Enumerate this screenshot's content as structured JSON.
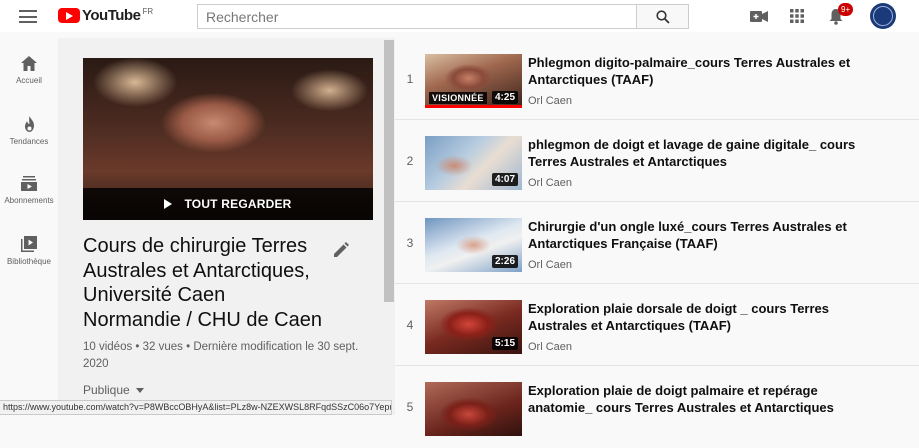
{
  "header": {
    "logo_text": "YouTube",
    "logo_country": "FR",
    "search_placeholder": "Rechercher",
    "notification_count": "9+",
    "avatar_label": "CAEN"
  },
  "sidebar": {
    "items": [
      {
        "label": "Accueil",
        "icon": "home-icon"
      },
      {
        "label": "Tendances",
        "icon": "fire-icon"
      },
      {
        "label": "Abonnements",
        "icon": "subscriptions-icon"
      },
      {
        "label": "Bibliothèque",
        "icon": "library-icon"
      }
    ]
  },
  "playlist": {
    "play_all_label": "TOUT REGARDER",
    "title": "Cours de chirurgie Terres Australes et Antarctiques, Université Caen Normandie / CHU de Caen",
    "meta": "10 vidéos • 32 vues • Dernière modification le 30 sept. 2020",
    "privacy": "Publique"
  },
  "videos": [
    {
      "index": "1",
      "title": "Phlegmon digito-palmaire_cours Terres Australes et Antarctiques (TAAF)",
      "channel": "Orl Caen",
      "duration": "4:25",
      "watched_label": "VISIONNÉE",
      "watched_progress": 1.0
    },
    {
      "index": "2",
      "title": "phlegmon de doigt et lavage de gaine digitale_ cours Terres Australes et Antarctiques",
      "channel": "Orl Caen",
      "duration": "4:07"
    },
    {
      "index": "3",
      "title": "Chirurgie d'un ongle luxé_cours Terres Australes et Antarctiques Française (TAAF)",
      "channel": "Orl Caen",
      "duration": "2:26"
    },
    {
      "index": "4",
      "title": "Exploration plaie dorsale de doigt _ cours Terres Australes et Antarctiques (TAAF)",
      "channel": "Orl Caen",
      "duration": "5:15"
    },
    {
      "index": "5",
      "title": "Exploration plaie de doigt palmaire et repérage anatomie_ cours Terres Australes et Antarctiques",
      "channel": "",
      "duration": ""
    }
  ],
  "status_url": "https://www.youtube.com/watch?v=P8WBccOBHyA&list=PLz8w-NZEXWSL8RFqdSSzC06o7YepuvxsS"
}
